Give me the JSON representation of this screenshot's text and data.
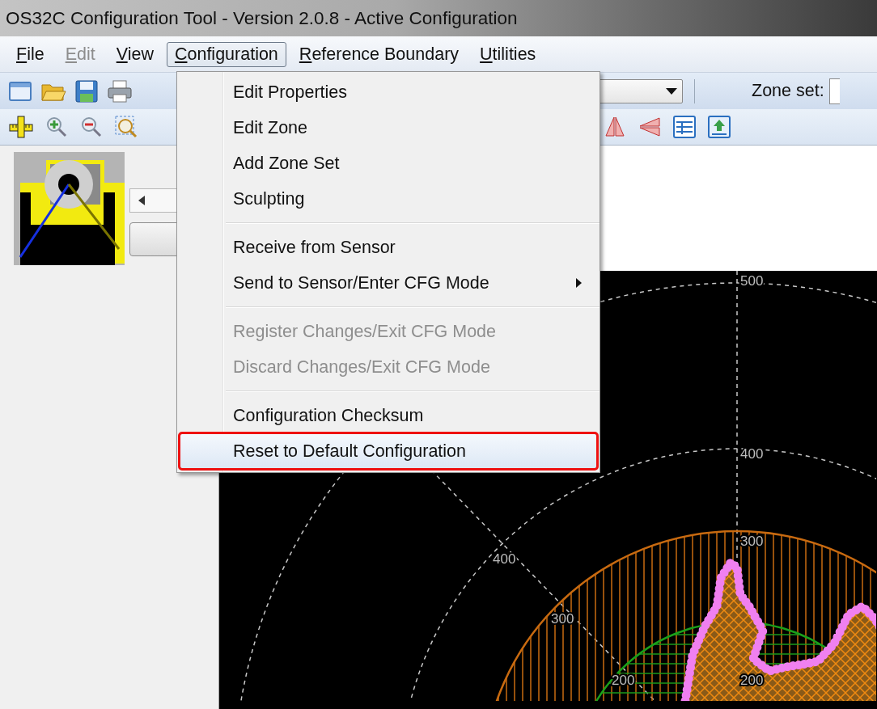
{
  "window": {
    "title": "OS32C Configuration Tool - Version 2.0.8 - Active Configuration"
  },
  "menu_bar": [
    {
      "label": "File",
      "disabled": false,
      "selected": false
    },
    {
      "label": "Edit",
      "disabled": true,
      "selected": false
    },
    {
      "label": "View",
      "disabled": false,
      "selected": false
    },
    {
      "label": "Configuration",
      "disabled": false,
      "selected": true
    },
    {
      "label": "Reference Boundary",
      "disabled": false,
      "selected": false
    },
    {
      "label": "Utilities",
      "disabled": false,
      "selected": false
    }
  ],
  "toolbar": {
    "zone_set_label": "Zone set:"
  },
  "configuration_menu": {
    "items": [
      {
        "kind": "item",
        "label": "Edit Properties",
        "disabled": false,
        "submenu": false,
        "selected": false,
        "outlined": false
      },
      {
        "kind": "item",
        "label": "Edit Zone",
        "disabled": false,
        "submenu": false,
        "selected": false,
        "outlined": false
      },
      {
        "kind": "item",
        "label": "Add Zone Set",
        "disabled": false,
        "submenu": false,
        "selected": false,
        "outlined": false
      },
      {
        "kind": "item",
        "label": "Sculpting",
        "disabled": false,
        "submenu": false,
        "selected": false,
        "outlined": false
      },
      {
        "kind": "separator"
      },
      {
        "kind": "item",
        "label": "Receive from Sensor",
        "disabled": false,
        "submenu": false,
        "selected": false,
        "outlined": false
      },
      {
        "kind": "item",
        "label": "Send to Sensor/Enter CFG Mode",
        "disabled": false,
        "submenu": true,
        "selected": false,
        "outlined": false
      },
      {
        "kind": "separator"
      },
      {
        "kind": "item",
        "label": "Register Changes/Exit CFG Mode",
        "disabled": true,
        "submenu": false,
        "selected": false,
        "outlined": false
      },
      {
        "kind": "item",
        "label": "Discard Changes/Exit CFG Mode",
        "disabled": true,
        "submenu": false,
        "selected": false,
        "outlined": false
      },
      {
        "kind": "separator"
      },
      {
        "kind": "item",
        "label": "Configuration Checksum",
        "disabled": false,
        "submenu": false,
        "selected": false,
        "outlined": false
      },
      {
        "kind": "item",
        "label": "Reset to Default Configuration",
        "disabled": false,
        "submenu": false,
        "selected": true,
        "outlined": true
      }
    ]
  },
  "plot": {
    "ring_labels": [
      "500",
      "400",
      "300",
      "200"
    ],
    "diagonal_labels": [
      "400",
      "300",
      "200"
    ]
  }
}
